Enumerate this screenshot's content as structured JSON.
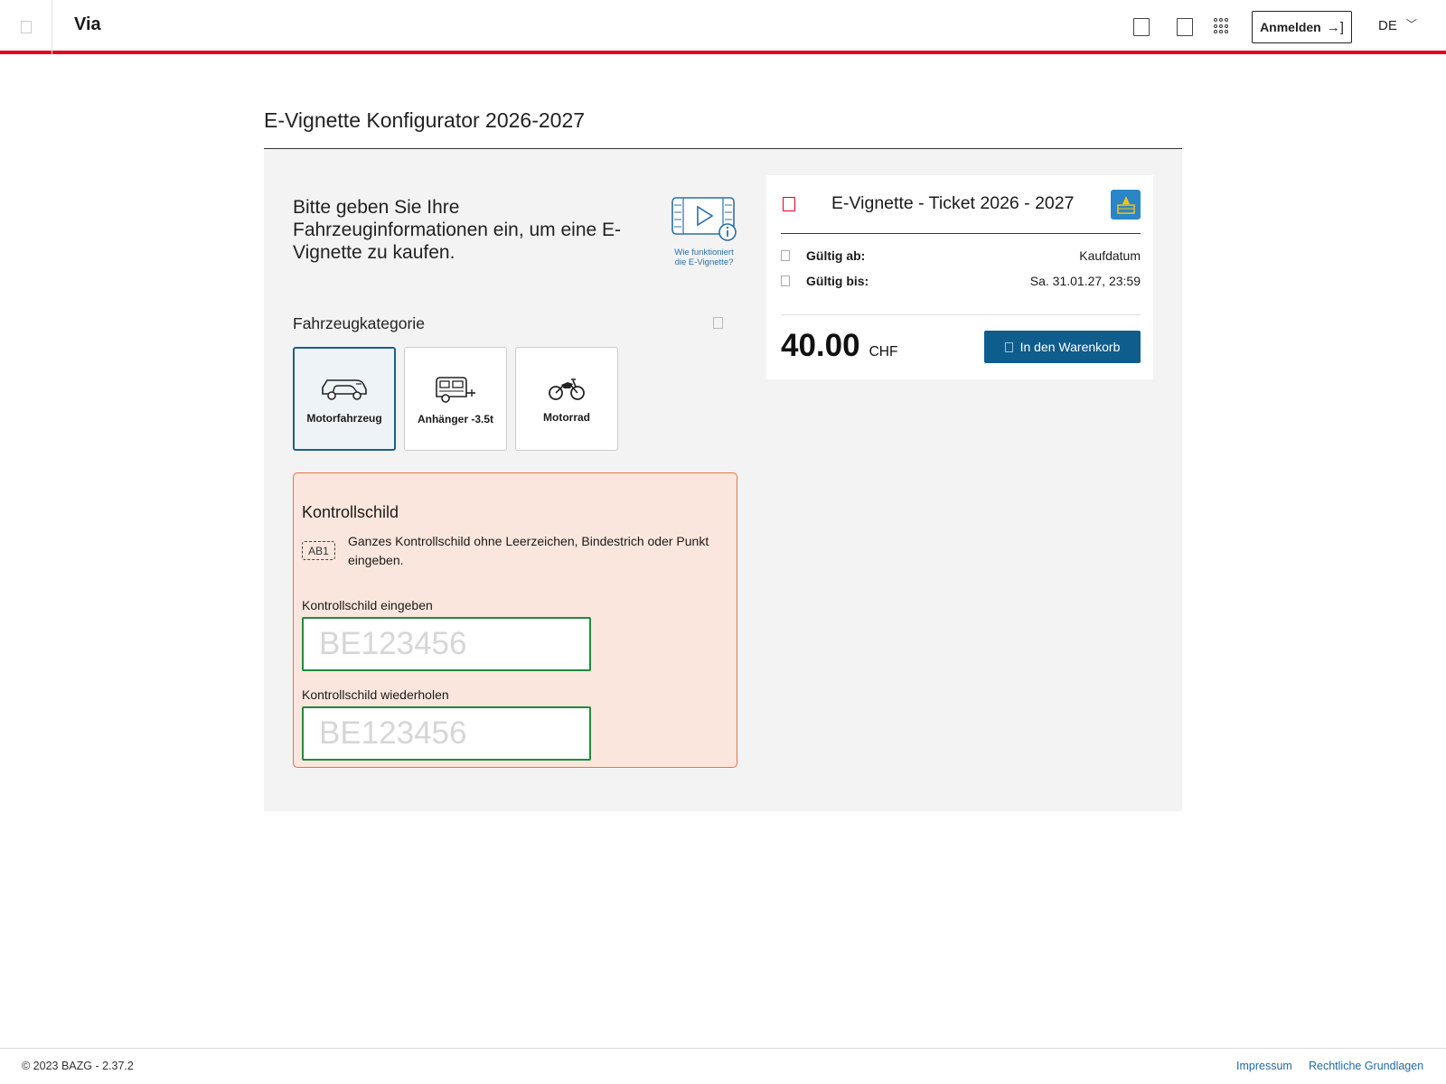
{
  "header": {
    "brand": "Via",
    "login_label": "Anmelden",
    "login_icon": "→]",
    "language": "DE",
    "language_chevron": "﹀"
  },
  "page": {
    "title": "E-Vignette Konfigurator 2026-2027"
  },
  "intro": {
    "text": "Bitte geben Sie Ihre Fahrzeuginformationen ein, um eine E-Vignette zu kaufen.",
    "help_caption": "Wie funktioniert die E-Vignette?"
  },
  "category": {
    "title": "Fahrzeugkategorie",
    "options": [
      {
        "label": "Motorfahrzeug",
        "icon": "car-icon",
        "selected": true
      },
      {
        "label": "Anhänger -3.5t",
        "icon": "trailer-icon",
        "selected": false
      },
      {
        "label": "Motorrad",
        "icon": "motorcycle-icon",
        "selected": false
      }
    ]
  },
  "plate": {
    "title": "Kontrollschild",
    "example": "AB1",
    "hint": "Ganzes Kontrollschild ohne Leerzeichen, Bindestrich oder Punkt eingeben.",
    "field1_label": "Kontrollschild eingeben",
    "field1_placeholder": "BE123456",
    "field2_label": "Kontrollschild wiederholen",
    "field2_placeholder": "BE123456"
  },
  "ticket": {
    "title": "E-Vignette - Ticket 2026 - 2027",
    "valid_from_label": "Gültig ab:",
    "valid_from_value": "Kaufdatum",
    "valid_to_label": "Gültig bis:",
    "valid_to_value": "Sa. 31.01.27, 23:59",
    "price": "40.00",
    "currency": "CHF",
    "cart_label": "In den Warenkorb"
  },
  "footer": {
    "copyright": "© 2023 BAZG - 2.37.2",
    "links": [
      "Impressum",
      "Rechtliche Grundlagen"
    ]
  },
  "colors": {
    "accent_red": "#e2001a",
    "primary_blue": "#0f5d8c",
    "input_green": "#1f8a3d",
    "plate_bg": "#fbe6dd",
    "plate_border": "#e5734a"
  }
}
